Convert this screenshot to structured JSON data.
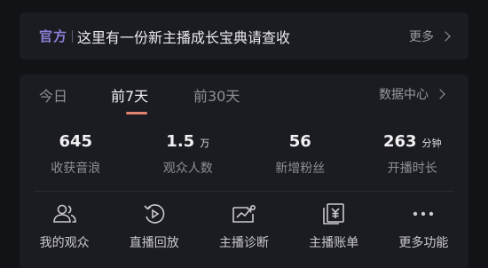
{
  "notice": {
    "badge": "官方",
    "message": "这里有一份新主播成长宝典请查收",
    "more": "更多"
  },
  "tabs": [
    {
      "label": "今日",
      "active": false
    },
    {
      "label": "前7天",
      "active": true
    },
    {
      "label": "前30天",
      "active": false
    }
  ],
  "data_center": "数据中心",
  "stats": [
    {
      "value": "645",
      "unit": "",
      "label": "收获音浪"
    },
    {
      "value": "1.5",
      "unit": "万",
      "label": "观众人数"
    },
    {
      "value": "56",
      "unit": "",
      "label": "新增粉丝"
    },
    {
      "value": "263",
      "unit": "分钟",
      "label": "开播时长"
    }
  ],
  "actions": [
    {
      "label": "我的观众",
      "icon": "audience-icon"
    },
    {
      "label": "直播回放",
      "icon": "replay-icon"
    },
    {
      "label": "主播诊断",
      "icon": "diagnosis-icon"
    },
    {
      "label": "主播账单",
      "icon": "bill-icon"
    },
    {
      "label": "更多功能",
      "icon": "more-dots-icon"
    }
  ],
  "colors": {
    "background": "#121317",
    "card": "#1b1c22",
    "badge": "#8a7fd6",
    "tab_indicator": "#e3826e"
  }
}
